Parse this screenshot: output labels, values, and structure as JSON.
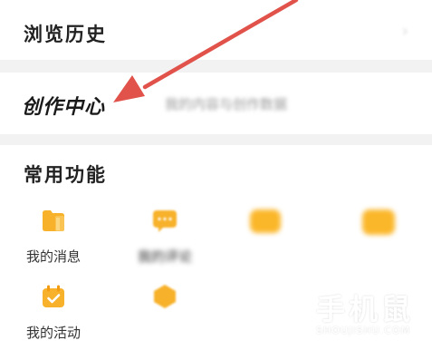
{
  "sections": {
    "history": {
      "title": "浏览历史",
      "arrow": "›"
    },
    "creator": {
      "title": "创作中心",
      "desc": "我的内容与创作数据"
    },
    "functions": {
      "title": "常用功能",
      "items": [
        {
          "label": "我的消息",
          "icon": "folder-icon"
        },
        {
          "label": "我的评论",
          "icon": "chat-icon"
        },
        {
          "label": "",
          "icon": "cloud-icon"
        },
        {
          "label": "",
          "icon": "card-icon"
        },
        {
          "label": "我的活动",
          "icon": "calendar-icon"
        },
        {
          "label": "",
          "icon": "hexagon-icon"
        }
      ]
    }
  },
  "watermark": {
    "title": "手机鼠",
    "subtitle": "SHOUJISHU.COM"
  },
  "colors": {
    "accent": "#fbb72a",
    "arrow": "#e0524a",
    "background": "#f2f2f2"
  }
}
